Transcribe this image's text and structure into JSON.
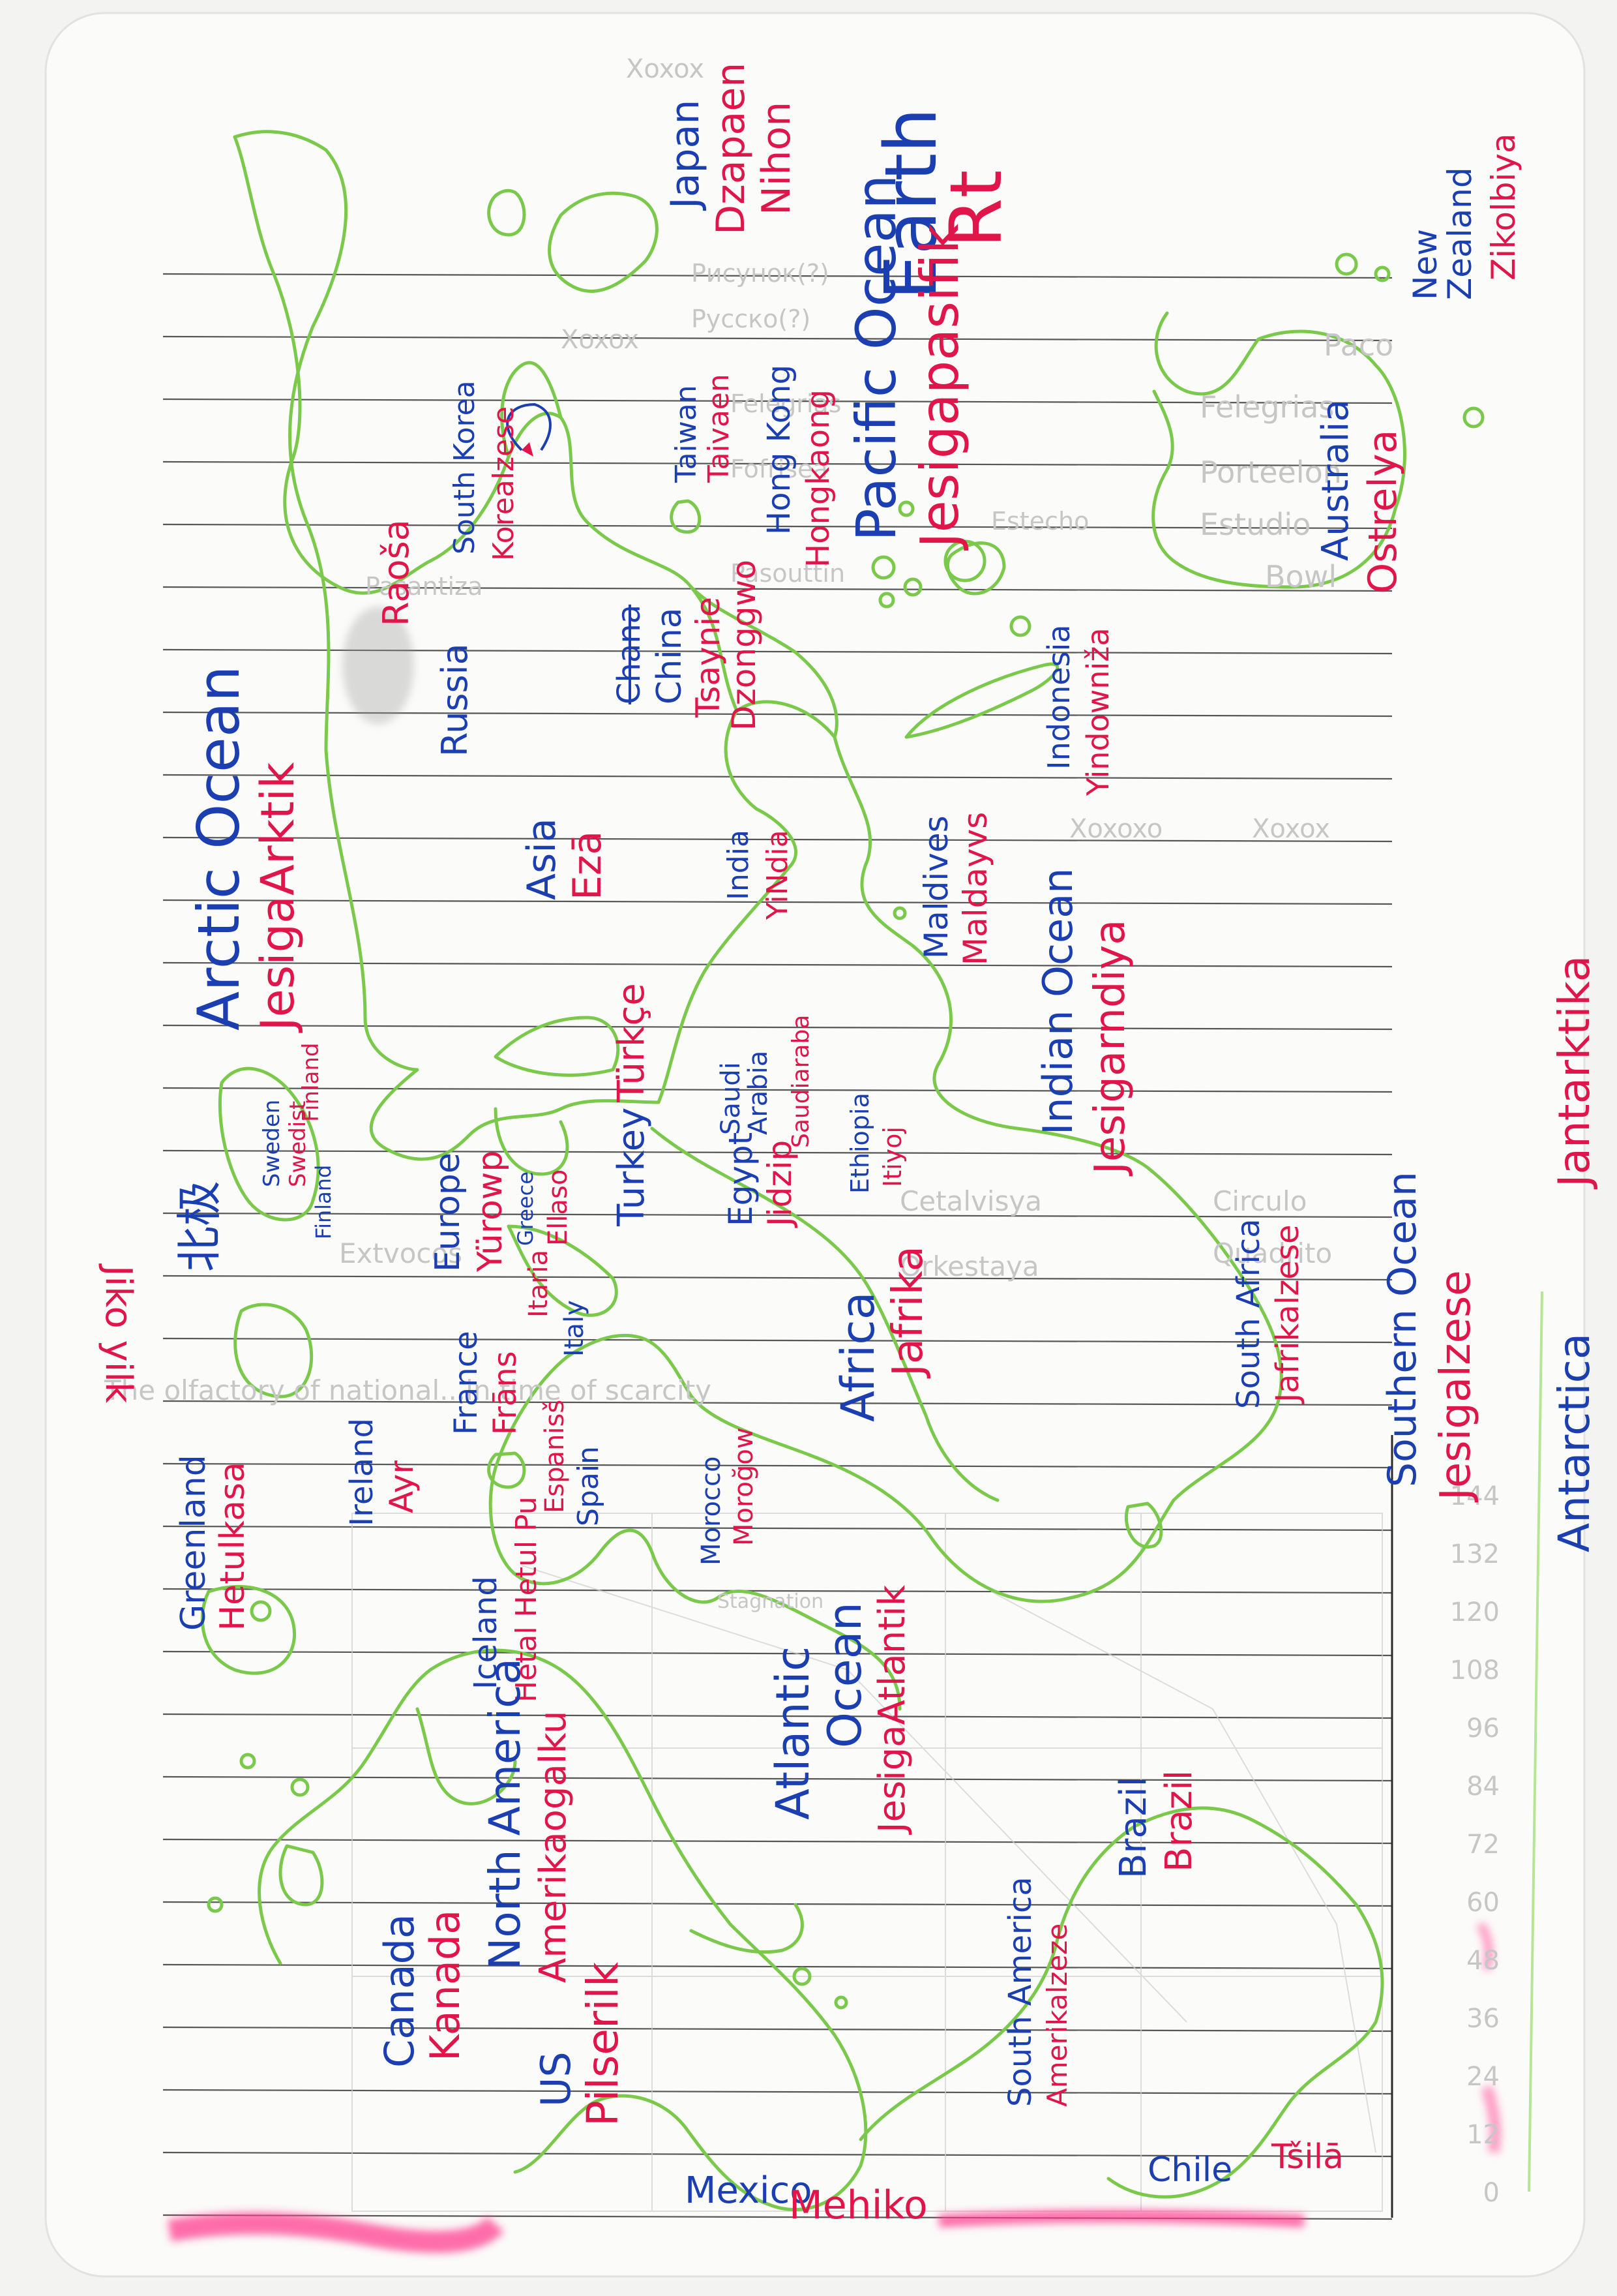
{
  "paper": {
    "corner_header": "Xoxox",
    "faint_grid_text": [
      "Рисунок(?)",
      "Русско(?)",
      "Xoxox",
      "Paco",
      "Felegrias",
      "Porteelon",
      "Estudio",
      "Bowl",
      "Felegrias",
      "Fofrisea",
      "Estecho",
      "Pasouttin",
      "Pasantiza",
      "Xoxoxo",
      "Xoxox",
      "Circulo",
      "Quadrito",
      "Cetalvisya",
      "Orkestaya",
      "Extvocos",
      "The olfactory of national...in time of scarcity",
      "Stagnation"
    ],
    "faint_axis_ticks": [
      "144",
      "132",
      "120",
      "108",
      "96",
      "84",
      "72",
      "60",
      "48",
      "36",
      "24",
      "12",
      "0"
    ]
  },
  "title": {
    "english": "Earth",
    "conlang": "Rt"
  },
  "labels": {
    "japan": {
      "english": "Japan",
      "conlang": [
        "Dzapaen",
        "Nihon"
      ]
    },
    "south_korea": {
      "english": "South Korea",
      "conlang": "Korealzese"
    },
    "taiwan": {
      "english": "Taiwan",
      "conlang": "Taivaen"
    },
    "hong_kong": {
      "english": "Hong Kong",
      "conlang": "Hongkaong"
    },
    "china": {
      "english": "China",
      "conlang": [
        "Tsaynie",
        "Dzonggwo"
      ],
      "struck": "Chana"
    },
    "russia": {
      "english": "Russia",
      "conlang": "Raoša"
    },
    "asia": {
      "english": "Asia",
      "conlang": "Ezā"
    },
    "india": {
      "english": "India",
      "conlang": "YiNdia"
    },
    "indonesia": {
      "english": "Indonesia",
      "conlang": "Yindowniža"
    },
    "maldives": {
      "english": "Maldives",
      "conlang": "Maldayvs"
    },
    "saudi_arabia": {
      "english": "Saudi Arabia",
      "conlang": "Saudiaraba"
    },
    "ethiopia": {
      "english": "Ethiopia",
      "conlang": "Itiyoj"
    },
    "egypt": {
      "english": "Egypt",
      "conlang": "Jidzip"
    },
    "turkey": {
      "english": "Turkey",
      "conlang": "Türkçe"
    },
    "sweden": {
      "english": "Sweden",
      "conlang": "Swedist"
    },
    "finland": {
      "english": "Finland",
      "conlang": "Finland"
    },
    "europe": {
      "english": "Europe",
      "conlang": "Yürowp"
    },
    "greece": {
      "english": "Greece",
      "conlang": "Ellaso"
    },
    "italy": {
      "english": "Italy",
      "conlang": "Itaria"
    },
    "france": {
      "english": "France",
      "conlang": "Frāns"
    },
    "spain": {
      "english": "Spain",
      "conlang": "Espanisš"
    },
    "morocco": {
      "english": "Morocco",
      "conlang": "Moroğow"
    },
    "africa": {
      "english": "Africa",
      "conlang": "Jafrika"
    },
    "south_africa": {
      "english": "South Africa",
      "conlang": "Jafrikalzese"
    },
    "ireland": {
      "english": "Ireland",
      "conlang": "Ayr"
    },
    "iceland": {
      "english": "Iceland",
      "conlang": "Hetal Hetul Pu"
    },
    "greenland": {
      "english": "Greenland",
      "conlang": "Hetulkasa"
    },
    "canada": {
      "english": "Canada",
      "conlang": "Kanada"
    },
    "north_america": {
      "english": "North America",
      "conlang": "Amerikaogalku"
    },
    "us": {
      "english": "US",
      "conlang": "Pilserilk"
    },
    "mexico": {
      "english": "Mexico",
      "conlang": "Mehiko"
    },
    "south_america": {
      "english": "South America",
      "conlang": "Amerikalzeze"
    },
    "brazil": {
      "english": "Brazil",
      "conlang": "Brazil"
    },
    "chile": {
      "english": "Chile",
      "conlang": "Tšilā"
    },
    "australia": {
      "english": "Australia",
      "conlang": "Ostrelya"
    },
    "new_zealand": {
      "english": "New Zealand",
      "conlang": "Zikolbiya"
    },
    "antarctica": {
      "english": "Antarctica",
      "conlang": "Jantarktika"
    },
    "north_pole": {
      "english": "北极",
      "conlang": "Jiko yilk"
    },
    "arctic_ocean": {
      "english": "Arctic Ocean",
      "conlang": "JesigaArktik"
    },
    "pacific_ocean": {
      "english": "Pacific Ocean",
      "conlang": "Jesigapasifik"
    },
    "indian_ocean": {
      "english": "Indian Ocean",
      "conlang": "Jesigarndiya"
    },
    "atlantic_ocean": {
      "english": [
        "Atlantic",
        "Ocean"
      ],
      "conlang": "JesigaAtlantik"
    },
    "southern_ocean": {
      "english": "Southern Ocean",
      "conlang": "Jesigalzese"
    }
  },
  "colors": {
    "paper": "#f3f3f1",
    "rule_lines": "#3a3a3a",
    "coastline": "#7ac94b",
    "english_ink": "#1b3fb0",
    "conlang_ink": "#e0154a",
    "highlighter_smudge": "#ff3d8f"
  }
}
